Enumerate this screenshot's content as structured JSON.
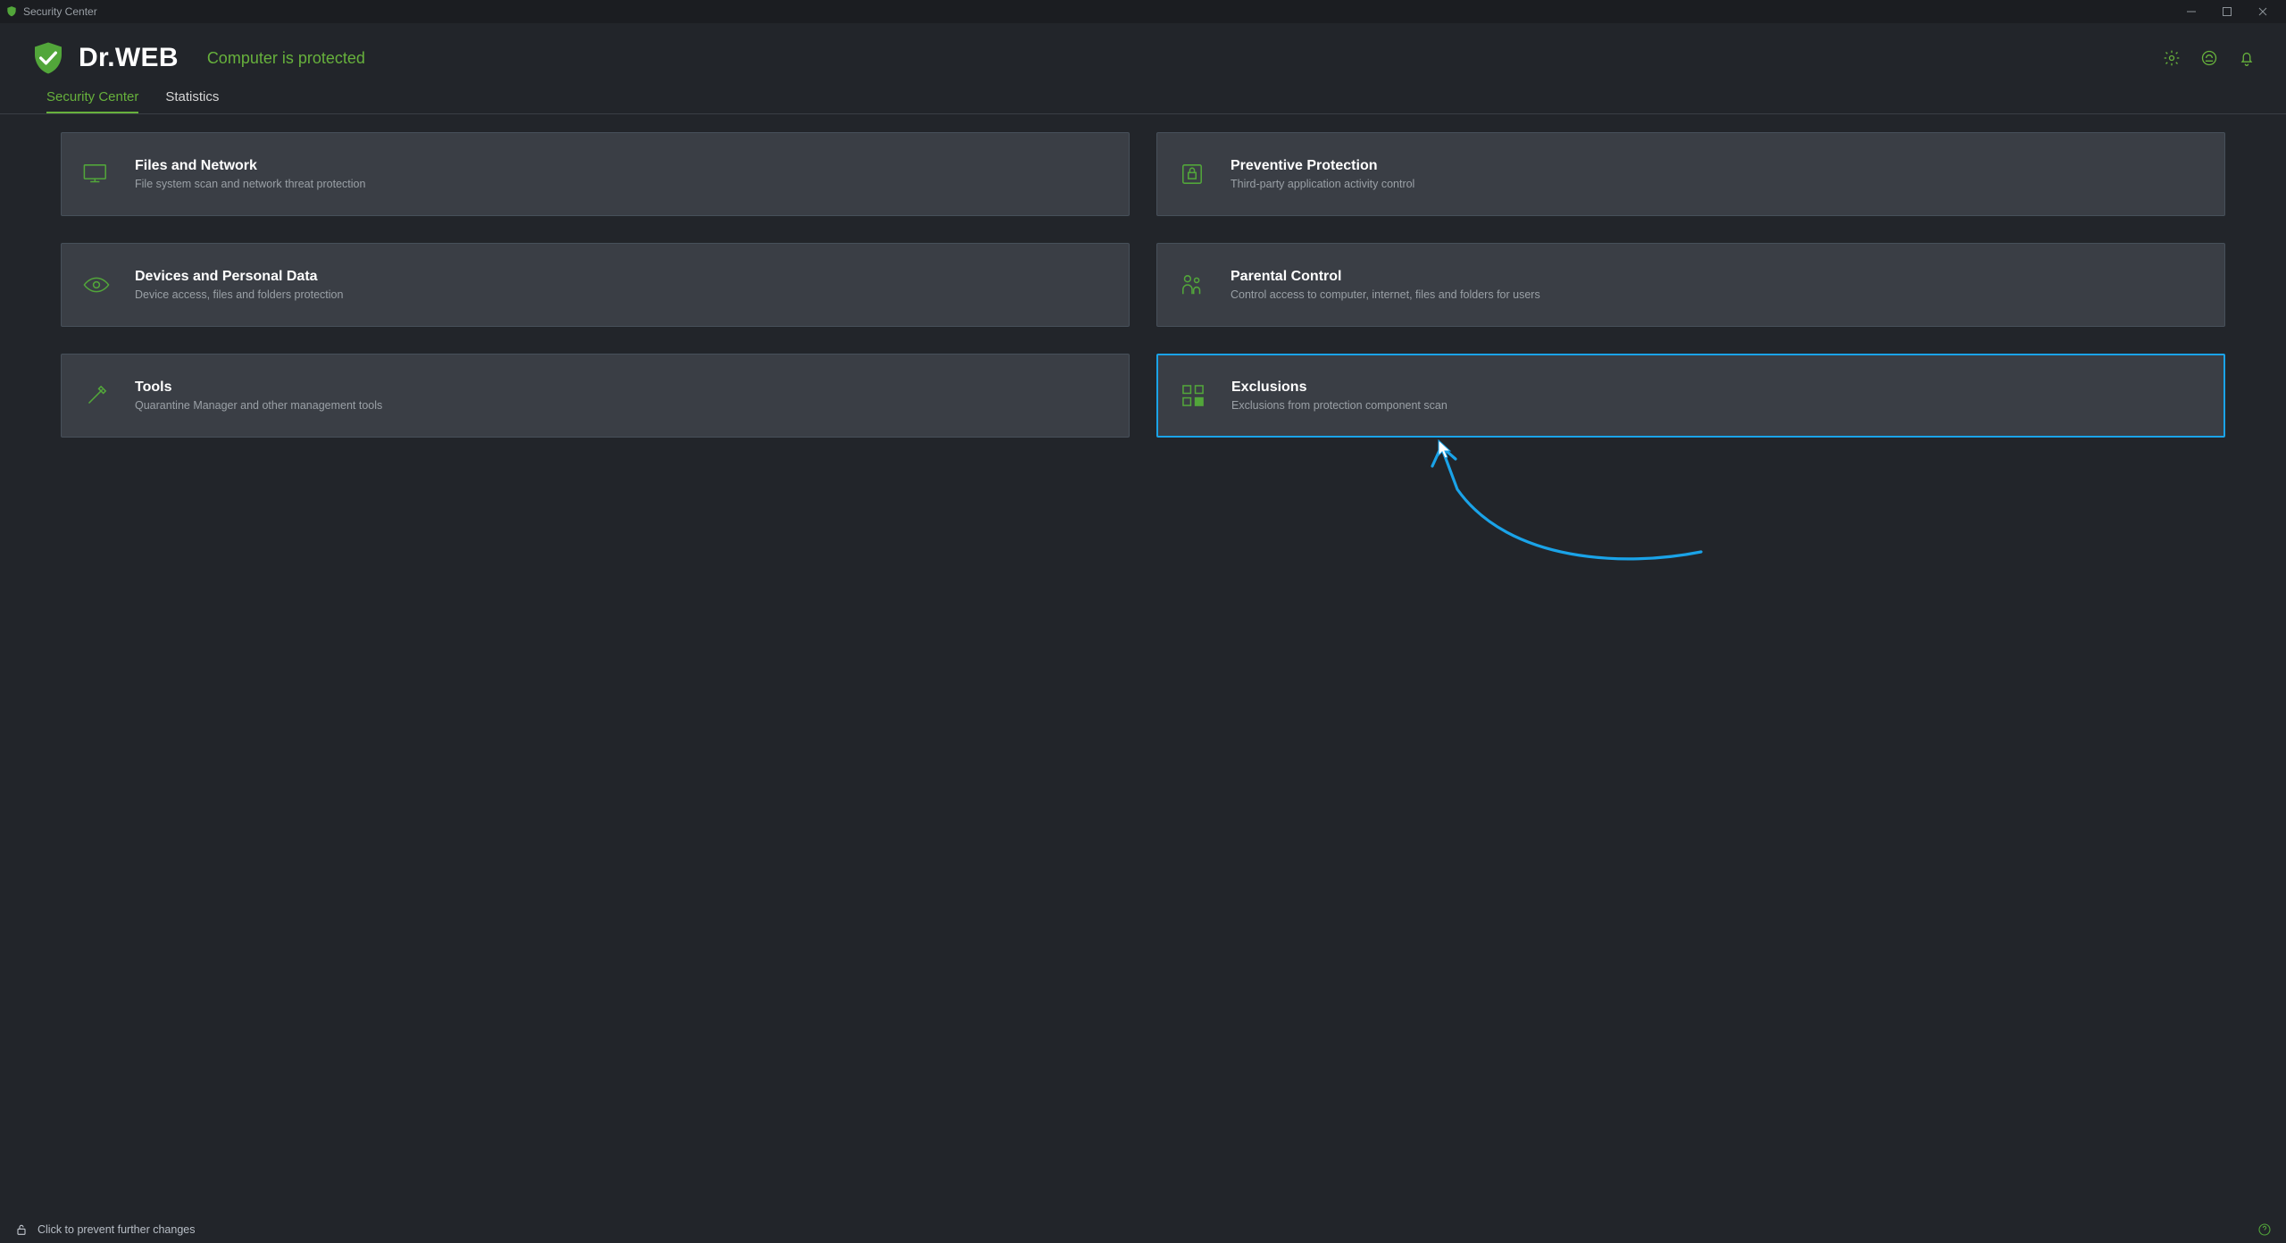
{
  "window": {
    "title": "Security Center"
  },
  "header": {
    "brand_prefix": "Dr.",
    "brand_suffix": "WEB",
    "status": "Computer is protected"
  },
  "tabs": [
    {
      "label": "Security Center",
      "active": true
    },
    {
      "label": "Statistics",
      "active": false
    }
  ],
  "panels": [
    {
      "id": "files-network",
      "title": "Files and Network",
      "desc": "File system scan and network threat protection"
    },
    {
      "id": "preventive",
      "title": "Preventive Protection",
      "desc": "Third-party application activity control"
    },
    {
      "id": "devices-data",
      "title": "Devices and Personal Data",
      "desc": "Device access, files and folders protection"
    },
    {
      "id": "parental",
      "title": "Parental Control",
      "desc": "Control access to computer, internet, files and folders for users"
    },
    {
      "id": "tools",
      "title": "Tools",
      "desc": "Quarantine Manager and other management tools"
    },
    {
      "id": "exclusions",
      "title": "Exclusions",
      "desc": "Exclusions from protection component scan",
      "selected": true
    }
  ],
  "statusbar": {
    "lock_text": "Click to prevent further changes"
  },
  "colors": {
    "accent_green": "#67b13c",
    "panel_bg": "#3a3e45",
    "highlight_blue": "#1aa3e8"
  }
}
